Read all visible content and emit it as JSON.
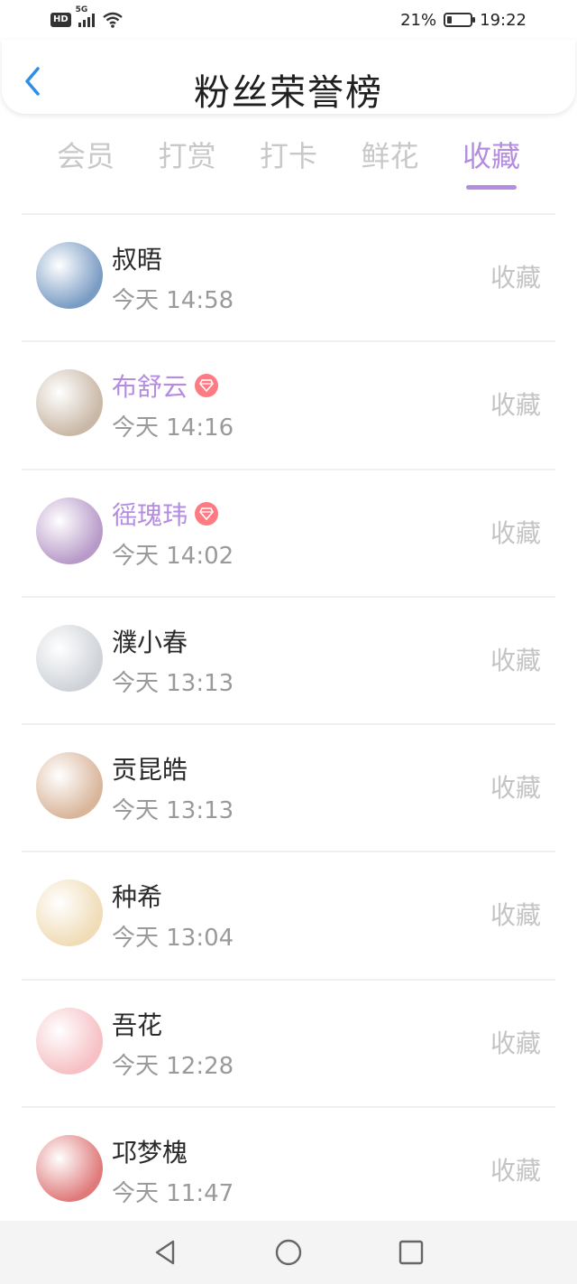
{
  "status_bar": {
    "hd": "HD",
    "network": "5G",
    "battery_text": "21%",
    "battery_level": 0.21,
    "time": "19:22"
  },
  "header": {
    "title": "粉丝荣誉榜",
    "back_icon": "chevron-left-icon"
  },
  "tabs": [
    {
      "label": "会员",
      "active": false
    },
    {
      "label": "打赏",
      "active": false
    },
    {
      "label": "打卡",
      "active": false
    },
    {
      "label": "鲜花",
      "active": false
    },
    {
      "label": "收藏",
      "active": true
    }
  ],
  "colors": {
    "accent": "#b48ce0",
    "vip_badge": "#ff7b83",
    "inactive_text": "#c8c8c8",
    "time_text": "#9a9a9a"
  },
  "list": [
    {
      "name": "叔晤",
      "time": "今天 14:58",
      "action": "收藏",
      "vip": false,
      "avatar": "#7a9cc4"
    },
    {
      "name": "布舒云",
      "time": "今天 14:16",
      "action": "收藏",
      "vip": true,
      "avatar": "#c9b8a6"
    },
    {
      "name": "徭瑰玮",
      "time": "今天 14:02",
      "action": "收藏",
      "vip": true,
      "avatar": "#b89ac9"
    },
    {
      "name": "濮小春",
      "time": "今天 13:13",
      "action": "收藏",
      "vip": false,
      "avatar": "#cfd3d8"
    },
    {
      "name": "贡昆皓",
      "time": "今天 13:13",
      "action": "收藏",
      "vip": false,
      "avatar": "#d9b59a"
    },
    {
      "name": "种希",
      "time": "今天 13:04",
      "action": "收藏",
      "vip": false,
      "avatar": "#f0dcb6"
    },
    {
      "name": "吾花",
      "time": "今天 12:28",
      "action": "收藏",
      "vip": false,
      "avatar": "#f6c0c4"
    },
    {
      "name": "邛梦槐",
      "time": "今天 11:47",
      "action": "收藏",
      "vip": false,
      "avatar": "#e07a7a"
    }
  ],
  "nav_bar": {
    "back": "triangle-back-icon",
    "home": "circle-home-icon",
    "recents": "square-recents-icon"
  }
}
